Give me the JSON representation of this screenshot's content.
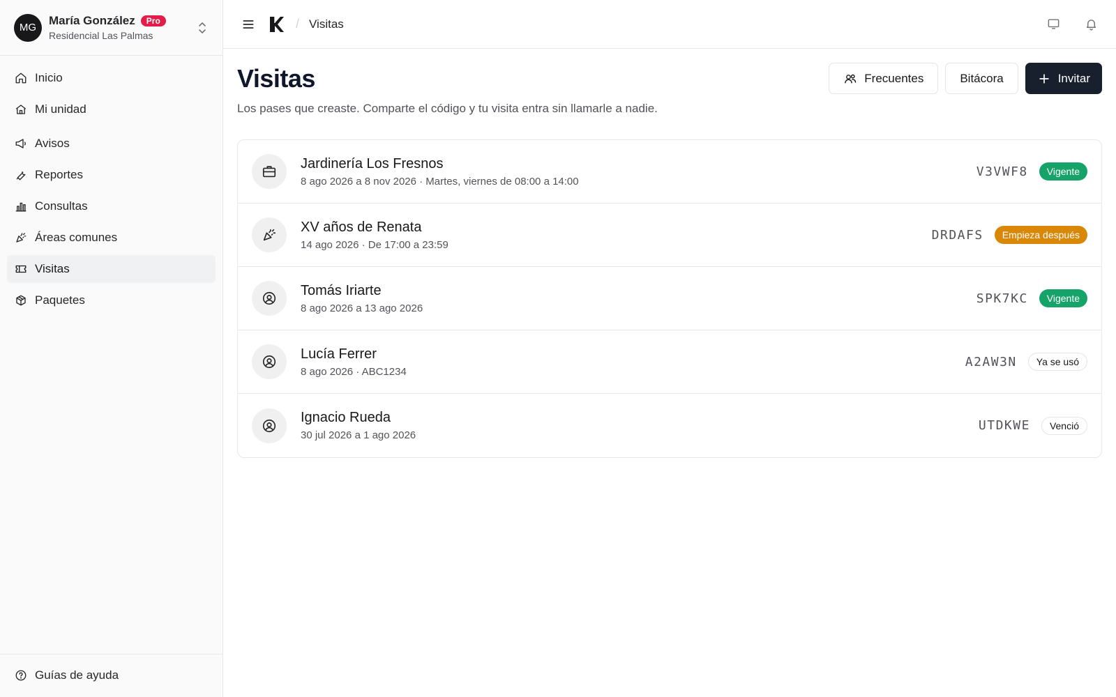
{
  "user": {
    "initials": "MG",
    "name": "María González",
    "plan": "Pro",
    "org": "Residencial Las Palmas"
  },
  "nav": {
    "items": [
      {
        "label": "Inicio",
        "icon": "home-icon"
      },
      {
        "label": "Mi unidad",
        "icon": "house-icon"
      },
      {
        "label": "Avisos",
        "icon": "megaphone-icon"
      },
      {
        "label": "Reportes",
        "icon": "wrench-icon"
      },
      {
        "label": "Consultas",
        "icon": "bar-chart-icon"
      },
      {
        "label": "Áreas comunes",
        "icon": "party-popper-icon"
      },
      {
        "label": "Visitas",
        "icon": "ticket-icon"
      },
      {
        "label": "Paquetes",
        "icon": "package-icon"
      }
    ],
    "active": "Visitas",
    "footer_label": "Guías de ayuda"
  },
  "header": {
    "breadcrumb": "Visitas"
  },
  "page": {
    "title": "Visitas",
    "subtitle": "Los pases que creaste. Comparte el código y tu visita entra sin llamarle a nadie.",
    "actions": {
      "frequent": "Frecuentes",
      "log": "Bitácora",
      "invite": "Invitar"
    }
  },
  "visits": [
    {
      "title": "Jardinería Los Fresnos",
      "meta": "8 ago 2026 a 8 nov 2026 · Martes, viernes de 08:00 a 14:00",
      "code": "V3VWF8",
      "status": "Vigente",
      "icon": "briefcase-icon"
    },
    {
      "title": "XV años de Renata",
      "meta": "14 ago 2026 · De 17:00 a 23:59",
      "code": "DRDAFS",
      "status": "Empieza después",
      "icon": "party-popper-icon"
    },
    {
      "title": "Tomás Iriarte",
      "meta": "8 ago 2026 a 13 ago 2026",
      "code": "SPK7KC",
      "status": "Vigente",
      "icon": "user-circle-icon"
    },
    {
      "title": "Lucía Ferrer",
      "meta": "8 ago 2026 · ABC1234",
      "code": "A2AW3N",
      "status": "Ya se usó",
      "icon": "user-circle-icon"
    },
    {
      "title": "Ignacio Rueda",
      "meta": "30 jul 2026 a 1 ago 2026",
      "code": "UTDKWE",
      "status": "Venció",
      "icon": "user-circle-icon"
    }
  ],
  "colors": {
    "accent": "#18202e",
    "status_active": "#16a36a",
    "status_upcoming": "#d98706",
    "plan_badge": "#e11d48"
  }
}
